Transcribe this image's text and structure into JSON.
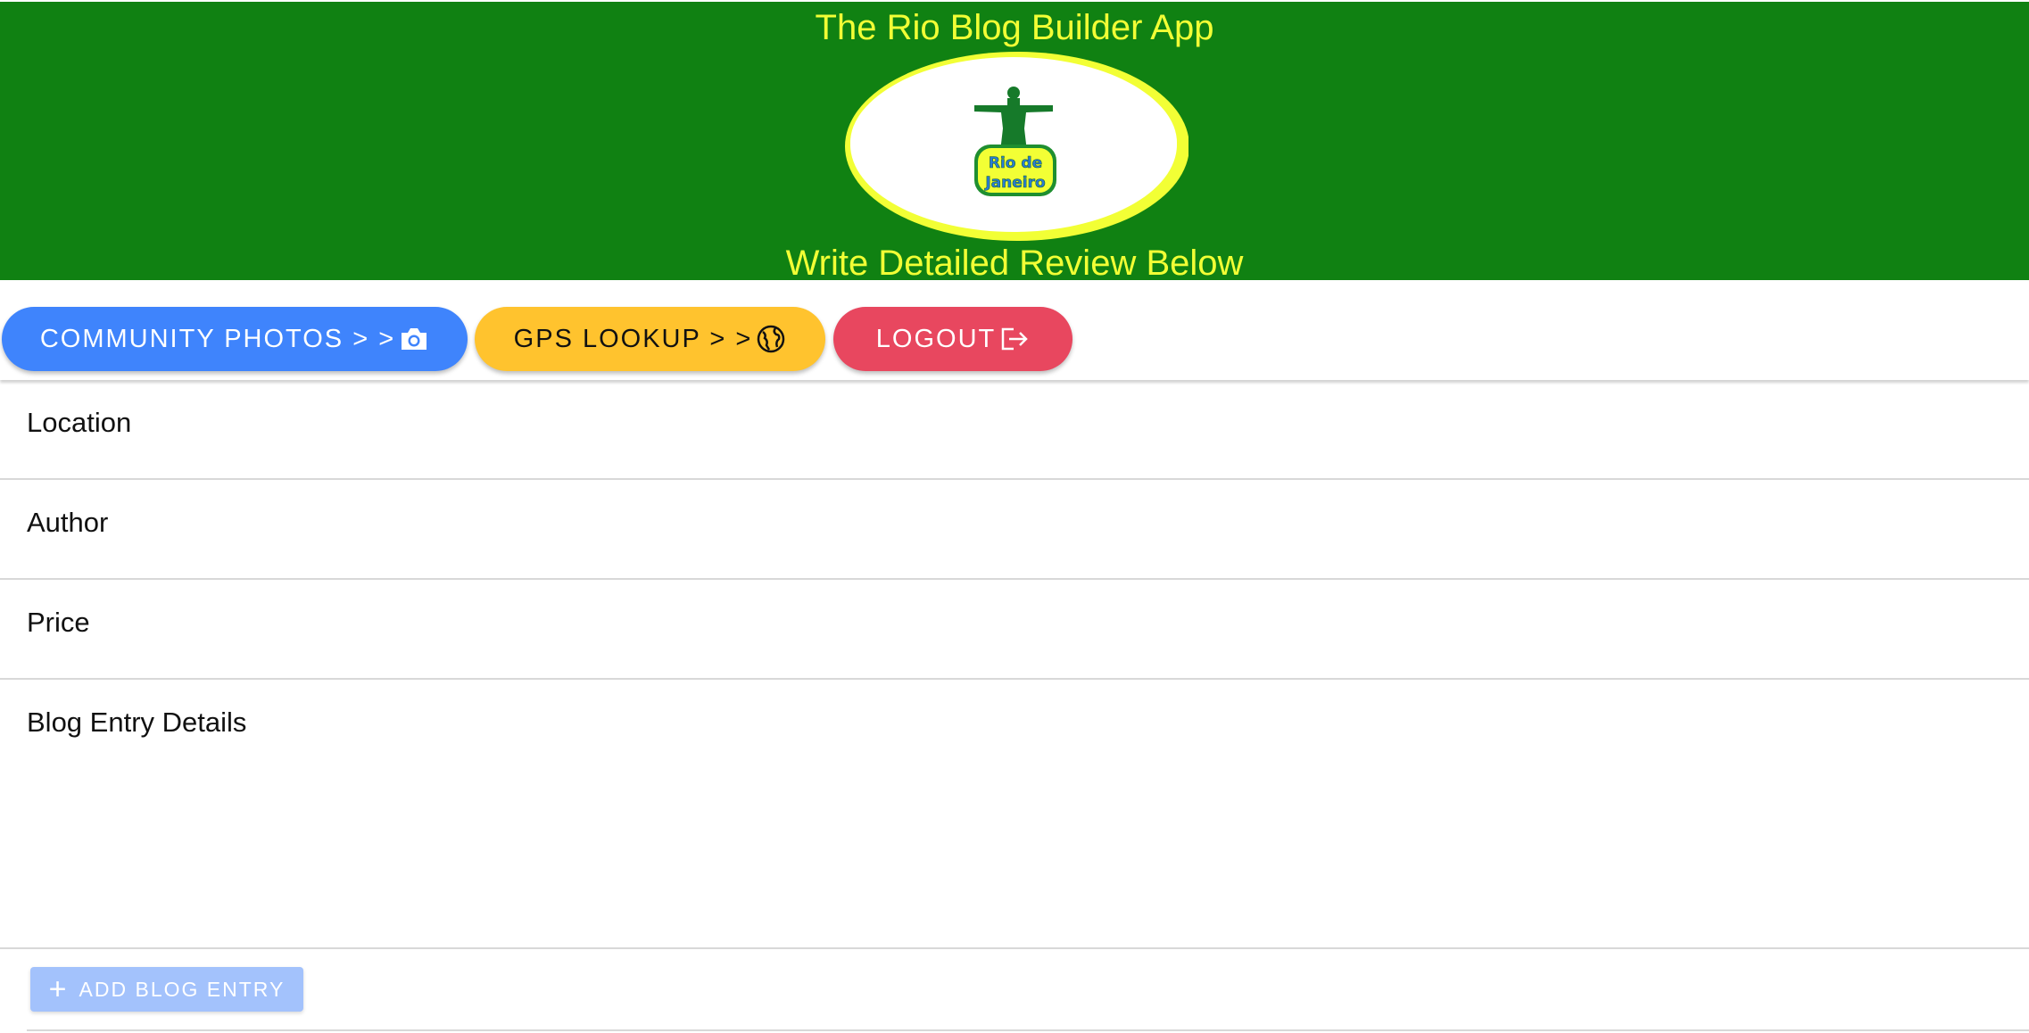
{
  "colors": {
    "header_bg": "#108112",
    "header_text": "#f2ff35",
    "button_blue": "#3f84fc",
    "button_yellow": "#ffc32e",
    "button_red": "#e8475f",
    "add_button": "#a3c2fc"
  },
  "header": {
    "title": "The Rio Blog Builder App",
    "subtitle": "Write Detailed Review Below",
    "logo_text_line1": "Rio de",
    "logo_text_line2": "Janeiro"
  },
  "toolbar": {
    "community_photos_label": "COMMUNITY PHOTOS > >",
    "community_photos_icon": "camera-icon",
    "gps_lookup_label": "GPS LOOKUP > >",
    "gps_lookup_icon": "globe-icon",
    "logout_label": "LOGOUT",
    "logout_icon": "logout-icon"
  },
  "form": {
    "location_label": "Location",
    "location_value": "",
    "author_label": "Author",
    "author_value": "",
    "price_label": "Price",
    "price_value": "",
    "details_label": "Blog Entry Details",
    "details_value": "",
    "add_button_label": "ADD BLOG ENTRY",
    "add_button_icon": "plus-icon"
  }
}
